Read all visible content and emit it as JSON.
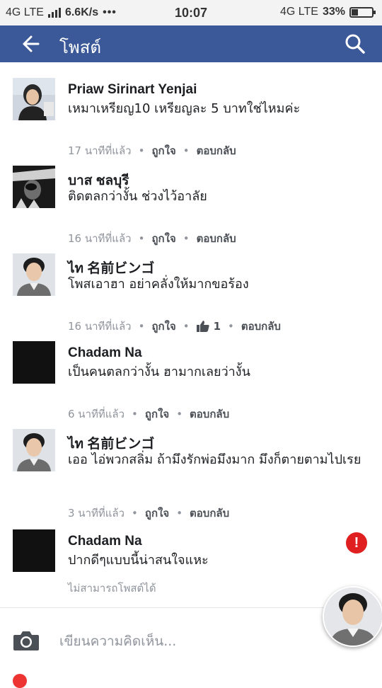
{
  "status_bar": {
    "network_left": "4G LTE",
    "speed": "6.6K/s",
    "dots": "•••",
    "time": "10:07",
    "network_right": "4G LTE",
    "battery_pct": "33%",
    "battery_level": 0.33
  },
  "app_bar": {
    "title": "โพสต์",
    "color": "#3b5998",
    "back_icon": "arrow-left-icon",
    "search_icon": "search-icon"
  },
  "comments": [
    {
      "author": "Priaw Sirinart Yenjai",
      "text": "เหมาเหรียญ10 เหรียญละ 5 บาทใช่ไหมค่ะ",
      "time": "17 นาทีที่แล้ว",
      "like_label": "ถูกใจ",
      "reply_label": "ตอบกลับ"
    },
    {
      "author": "บาส ชลบุรี",
      "text": "ติดตลกว่างั้น ช่วงไว้อาลัย",
      "time": "16 นาทีที่แล้ว",
      "like_label": "ถูกใจ",
      "reply_label": "ตอบกลับ"
    },
    {
      "author": "ไท 名前ビンゴ",
      "text": "โพสเอาฮา อย่าคลั่งให้มากขอร้อง",
      "time": "16 นาทีที่แล้ว",
      "like_label": "ถูกใจ",
      "like_count": "1",
      "reply_label": "ตอบกลับ"
    },
    {
      "author": "Chadam Na",
      "text": "เป็นคนตลกว่างั้น ฮามากเลยว่างั้น",
      "time": "6 นาทีที่แล้ว",
      "like_label": "ถูกใจ",
      "reply_label": "ตอบกลับ"
    },
    {
      "author": "ไท 名前ビンゴ",
      "text": "เออ ไอ่พวกสลิ่ม ถ้ามึงรักพ่อมึงมาก มึงก็ตายตามไปเรย",
      "time": "3 นาทีที่แล้ว",
      "like_label": "ถูกใจ",
      "reply_label": "ตอบกลับ"
    },
    {
      "author": "Chadam Na",
      "text": "ปากดีๆแบบนี้น่าสนใจแหะ",
      "failed_label": "ไม่สามารถโพสต์ได้",
      "error_badge": "!"
    }
  ],
  "composer": {
    "placeholder": "เขียนความคิดเห็น...",
    "camera_icon": "camera-icon"
  }
}
